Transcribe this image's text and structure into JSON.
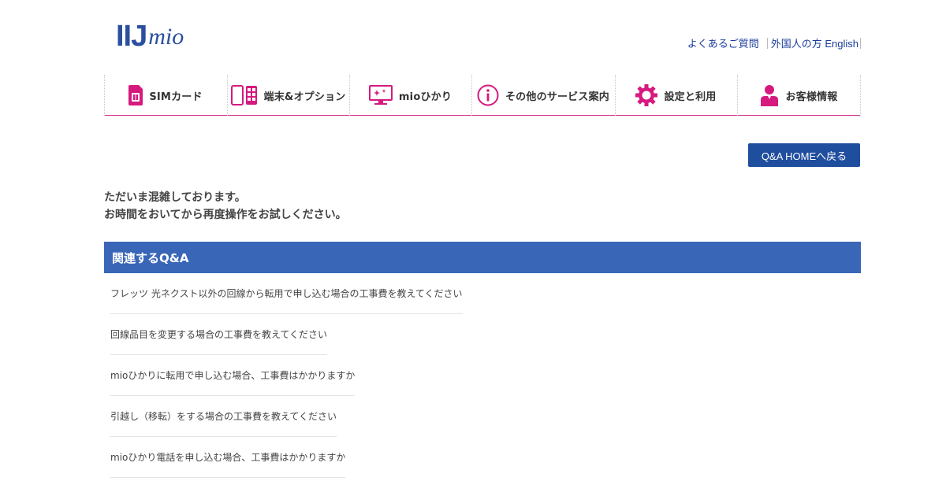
{
  "logo": {
    "brand": "IIJ",
    "sub": "mio"
  },
  "header": {
    "links": [
      {
        "label": "よくあるご質問"
      },
      {
        "label": "外国人の方 English"
      }
    ]
  },
  "nav": {
    "items": [
      {
        "label": "SIMカード",
        "icon": "sim-card-icon"
      },
      {
        "label": "端末&オプション",
        "icon": "devices-icon"
      },
      {
        "label": "mioひかり",
        "icon": "monitor-icon"
      },
      {
        "label": "その他のサービス案内",
        "icon": "info-icon"
      },
      {
        "label": "設定と利用",
        "icon": "gear-icon"
      },
      {
        "label": "お客様情報",
        "icon": "user-icon"
      }
    ],
    "accent_color": "#d6197f"
  },
  "back_button": {
    "label": "Q&A HOMEへ戻る"
  },
  "message": {
    "line1": "ただいま混雑しております。",
    "line2": "お時間をおいてから再度操作をお試しください。"
  },
  "related": {
    "title": "関連するQ&A",
    "items": [
      "フレッツ 光ネクスト以外の回線から転用で申し込む場合の工事費を教えてください",
      "回線品目を変更する場合の工事費を教えてください",
      "mioひかりに転用で申し込む場合、工事費はかかりますか",
      "引越し（移転）をする場合の工事費を教えてください",
      "mioひかり電話を申し込む場合、工事費はかかりますか"
    ]
  },
  "colors": {
    "brand_blue": "#2a4f9e",
    "header_bar": "#3a66b8",
    "button": "#1f4e9e"
  }
}
